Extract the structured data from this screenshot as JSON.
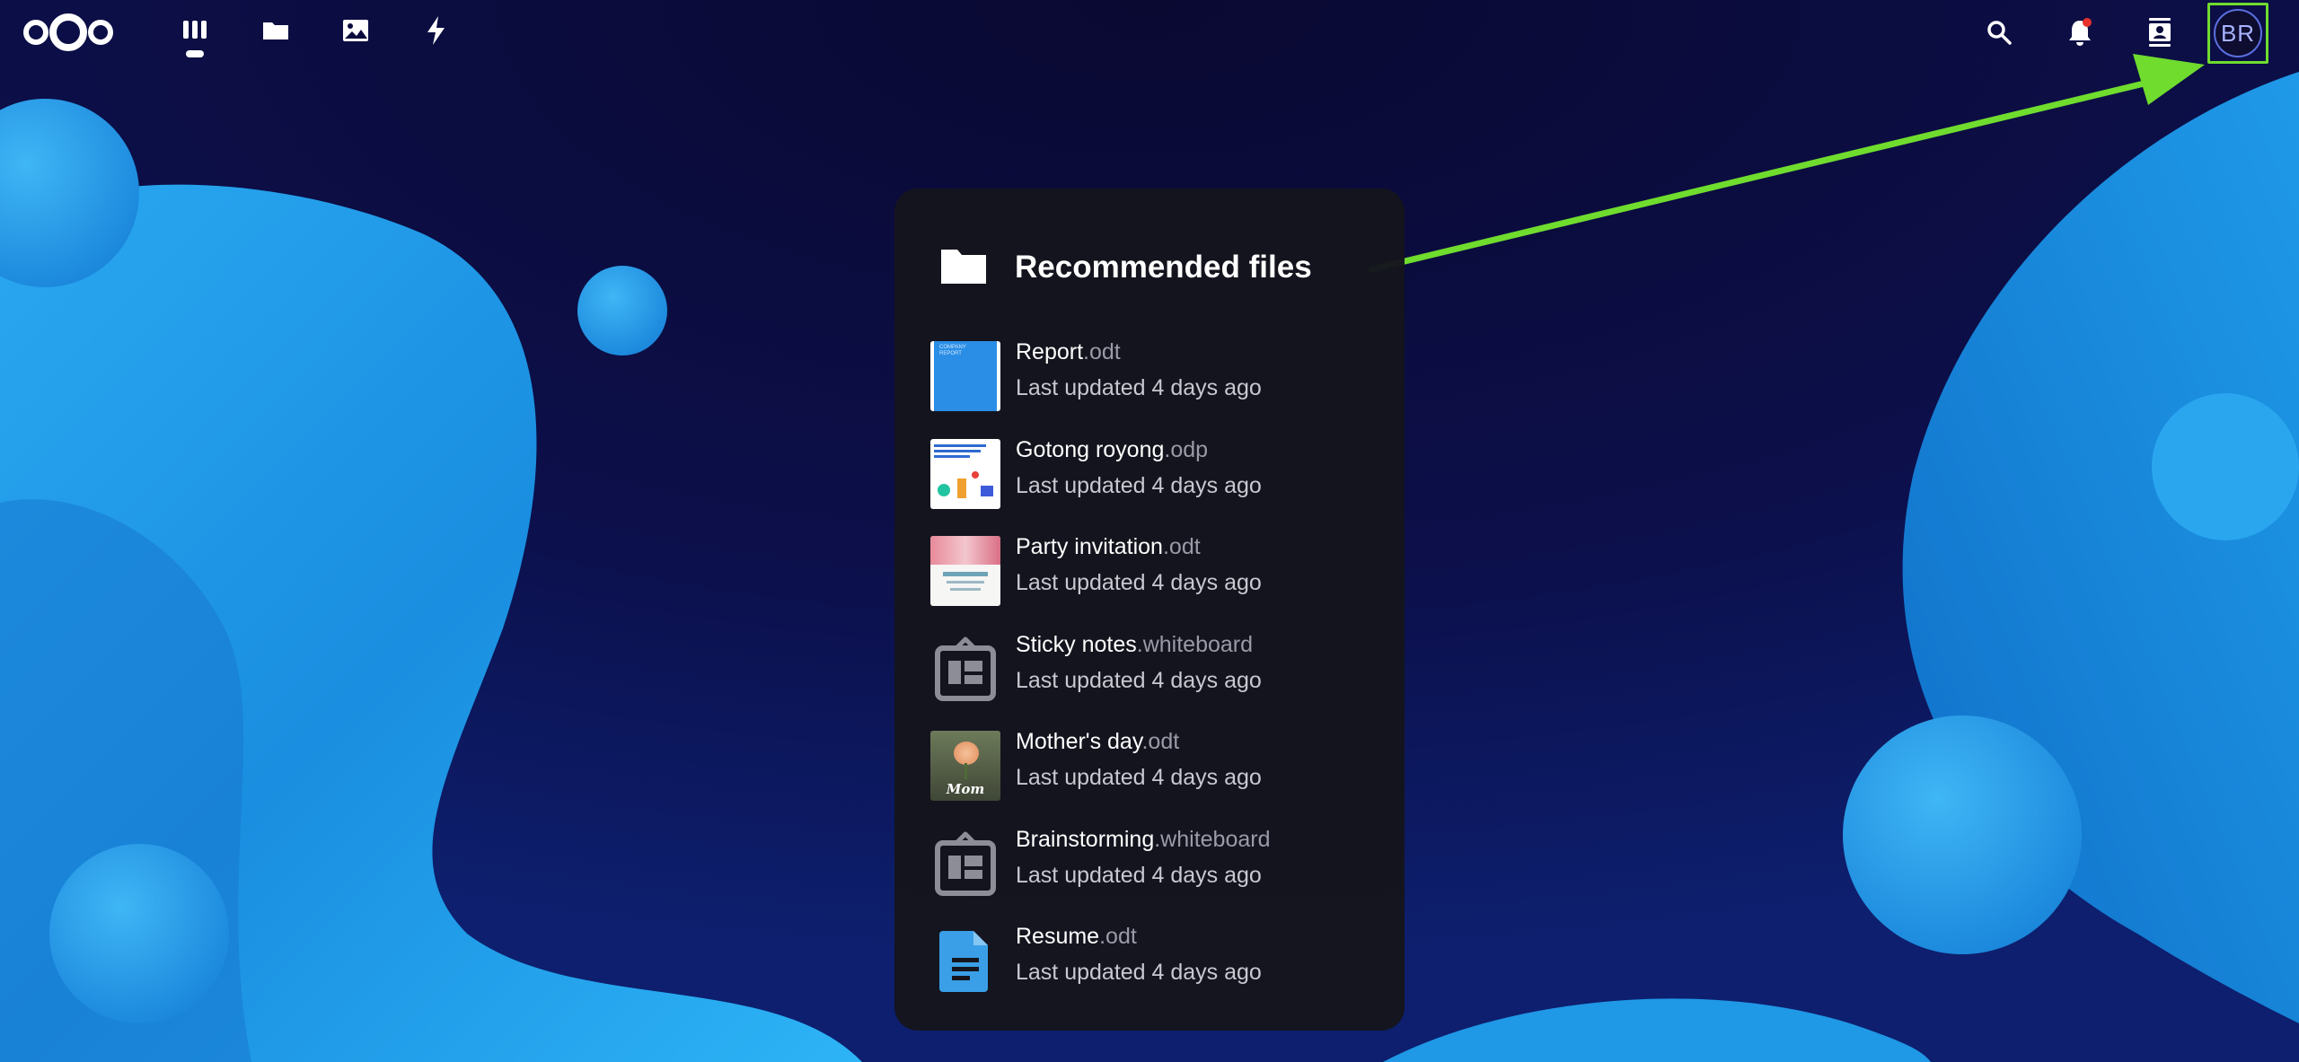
{
  "header": {
    "apps": [
      {
        "name": "dashboard",
        "icon": "dashboard-icon",
        "active": true
      },
      {
        "name": "files",
        "icon": "folder-icon"
      },
      {
        "name": "photos",
        "icon": "image-icon"
      },
      {
        "name": "activity",
        "icon": "lightning-icon"
      }
    ],
    "right_icons": [
      "search-icon",
      "notifications-bell-icon",
      "contacts-icon"
    ],
    "avatar_initials": "BR",
    "notification_dot_color": "#e9322d"
  },
  "widget": {
    "title": "Recommended files",
    "icon": "folder-icon",
    "files": [
      {
        "name": "Report",
        "ext": ".odt",
        "subtitle": "Last updated 4 days ago",
        "thumb": "report-thumbnail"
      },
      {
        "name": "Gotong royong",
        "ext": ".odp",
        "subtitle": "Last updated 4 days ago",
        "thumb": "presentation-thumbnail"
      },
      {
        "name": "Party invitation",
        "ext": ".odt",
        "subtitle": "Last updated 4 days ago",
        "thumb": "invitation-thumbnail"
      },
      {
        "name": "Sticky notes",
        "ext": ".whiteboard",
        "subtitle": "Last updated 4 days ago",
        "thumb": "whiteboard-icon"
      },
      {
        "name": "Mother's day",
        "ext": ".odt",
        "subtitle": "Last updated 4 days ago",
        "thumb": "rose-thumbnail"
      },
      {
        "name": "Brainstorming",
        "ext": ".whiteboard",
        "subtitle": "Last updated 4 days ago",
        "thumb": "whiteboard-icon"
      },
      {
        "name": "Resume",
        "ext": ".odt",
        "subtitle": "Last updated 4 days ago",
        "thumb": "document-icon"
      }
    ],
    "thumb_texts": {
      "report": "COMPANY REPORT",
      "mothers_day": "Mom"
    }
  },
  "annotation": {
    "type": "arrow",
    "color": "#6fdc2e",
    "points_to": "avatar"
  },
  "colors": {
    "background": "#0b0a3c",
    "shape_blue": "#1e9be8",
    "panel": "#15151d",
    "accent_green": "#6fdc2e",
    "doc_blue": "#3a9fe6"
  }
}
